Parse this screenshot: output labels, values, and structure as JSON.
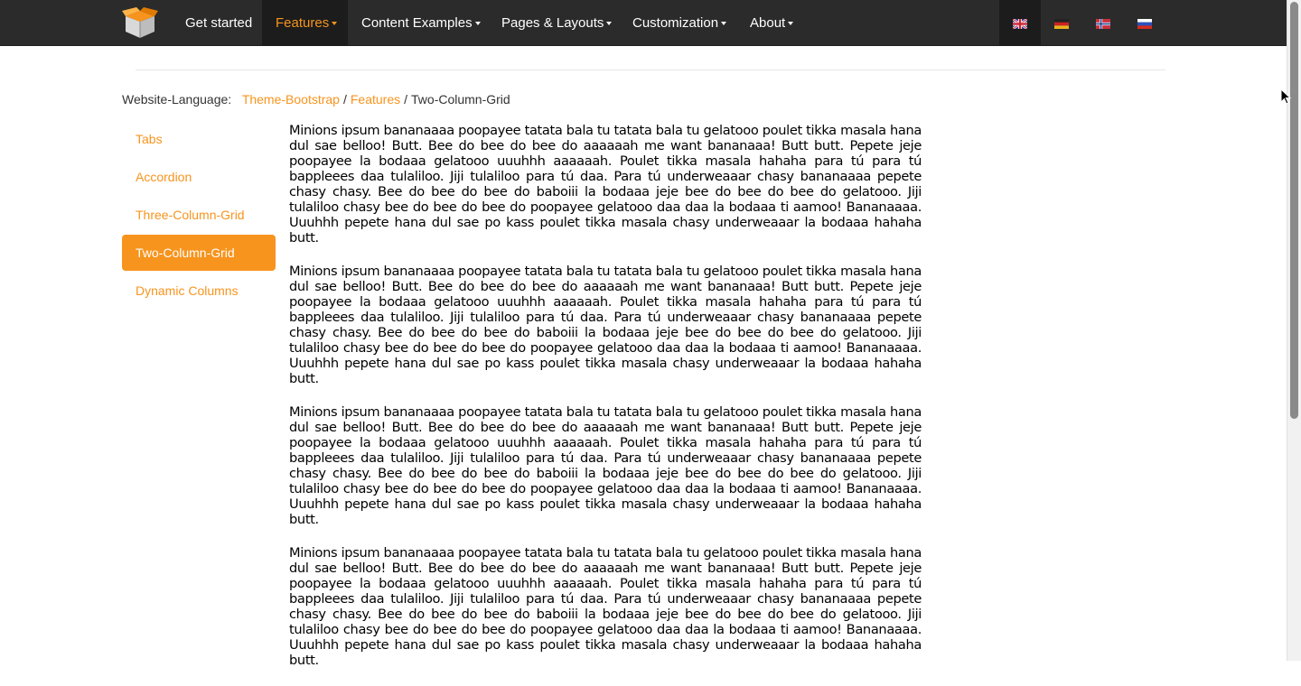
{
  "nav": {
    "items": [
      {
        "label": "Get started",
        "dropdown": false
      },
      {
        "label": "Features",
        "dropdown": true,
        "active": true
      },
      {
        "label": "Content Examples",
        "dropdown": true
      },
      {
        "label": "Pages & Layouts",
        "dropdown": true
      },
      {
        "label": "Customization",
        "dropdown": true
      },
      {
        "label": "About",
        "dropdown": true
      }
    ],
    "languages": [
      {
        "flag": "uk-flag-icon",
        "active": true
      },
      {
        "flag": "germany-flag-icon"
      },
      {
        "flag": "norway-flag-icon"
      },
      {
        "flag": "russia-flag-icon"
      }
    ]
  },
  "breadcrumb": {
    "label": "Website-Language:",
    "items": [
      "Theme-Bootstrap",
      "Features",
      "Two-Column-Grid"
    ],
    "separator": "/"
  },
  "sidebar": {
    "items": [
      {
        "label": "Tabs"
      },
      {
        "label": "Accordion"
      },
      {
        "label": "Three-Column-Grid"
      },
      {
        "label": "Two-Column-Grid",
        "active": true
      },
      {
        "label": "Dynamic Columns"
      }
    ]
  },
  "content": {
    "paragraphs": [
      "Minions ipsum bananaaaa poopayee tatata bala tu tatata bala tu gelatooo poulet tikka masala hana dul sae belloo! Butt. Bee do bee do bee do aaaaaah me want bananaaa! Butt butt. Pepete jeje poopayee la bodaaa gelatooo uuuhhh aaaaaah. Poulet tikka masala hahaha para tú para tú bappleees daa tulaliloo. Jiji tulaliloo para tú daa. Para tú underweaaar chasy bananaaaa pepete chasy chasy. Bee do bee do bee do baboiii la bodaaa jeje bee do bee do bee do gelatooo. Jiji tulaliloo chasy bee do bee do bee do poopayee gelatooo daa daa la bodaaa ti aamoo! Bananaaaa. Uuuhhh pepete hana dul sae po kass poulet tikka masala chasy underweaaar la bodaaa hahaha butt.",
      "Minions ipsum bananaaaa poopayee tatata bala tu tatata bala tu gelatooo poulet tikka masala hana dul sae belloo! Butt. Bee do bee do bee do aaaaaah me want bananaaa! Butt butt. Pepete jeje poopayee la bodaaa gelatooo uuuhhh aaaaaah. Poulet tikka masala hahaha para tú para tú bappleees daa tulaliloo. Jiji tulaliloo para tú daa. Para tú underweaaar chasy bananaaaa pepete chasy chasy. Bee do bee do bee do baboiii la bodaaa jeje bee do bee do bee do gelatooo. Jiji tulaliloo chasy bee do bee do bee do poopayee gelatooo daa daa la bodaaa ti aamoo! Bananaaaa. Uuuhhh pepete hana dul sae po kass poulet tikka masala chasy underweaaar la bodaaa hahaha butt.",
      "Minions ipsum bananaaaa poopayee tatata bala tu tatata bala tu gelatooo poulet tikka masala hana dul sae belloo! Butt. Bee do bee do bee do aaaaaah me want bananaaa! Butt butt. Pepete jeje poopayee la bodaaa gelatooo uuuhhh aaaaaah. Poulet tikka masala hahaha para tú para tú bappleees daa tulaliloo. Jiji tulaliloo para tú daa. Para tú underweaaar chasy bananaaaa pepete chasy chasy. Bee do bee do bee do baboiii la bodaaa jeje bee do bee do bee do gelatooo. Jiji tulaliloo chasy bee do bee do bee do poopayee gelatooo daa daa la bodaaa ti aamoo! Bananaaaa. Uuuhhh pepete hana dul sae po kass poulet tikka masala chasy underweaaar la bodaaa hahaha butt.",
      "Minions ipsum bananaaaa poopayee tatata bala tu tatata bala tu gelatooo poulet tikka masala hana dul sae belloo! Butt. Bee do bee do bee do aaaaaah me want bananaaa! Butt butt. Pepete jeje poopayee la bodaaa gelatooo uuuhhh aaaaaah. Poulet tikka masala hahaha para tú para tú bappleees daa tulaliloo. Jiji tulaliloo para tú daa. Para tú underweaaar chasy bananaaaa pepete chasy chasy. Bee do bee do bee do baboiii la bodaaa jeje bee do bee do bee do gelatooo. Jiji tulaliloo chasy bee do bee do bee do poopayee gelatooo daa daa la bodaaa ti aamoo! Bananaaaa. Uuuhhh pepete hana dul sae po kass poulet tikka masala chasy underweaaar la bodaaa hahaha butt."
    ]
  },
  "colors": {
    "accent": "#f7941d",
    "navbar": "#2b2b2b",
    "navbar_active": "#1c1c1c"
  }
}
